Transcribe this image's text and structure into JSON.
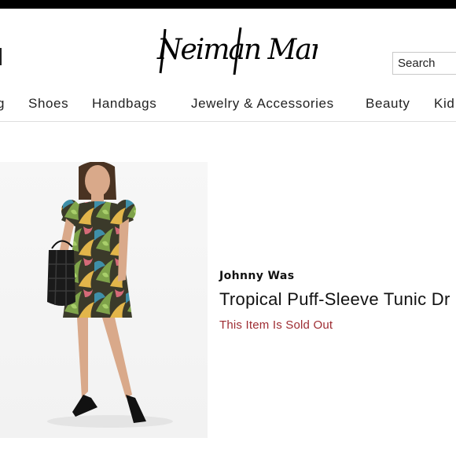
{
  "header": {
    "logo_text": "Neiman Marcus",
    "search": {
      "placeholder": "Search"
    }
  },
  "nav": {
    "items": [
      {
        "label": "g"
      },
      {
        "label": "Shoes"
      },
      {
        "label": "Handbags"
      },
      {
        "label": "Jewelry & Accessories"
      },
      {
        "label": "Beauty"
      },
      {
        "label": "Kid"
      }
    ]
  },
  "product": {
    "brand": "Johnny Was",
    "name": "Tropical Puff-Sleeve Tunic Dr",
    "status": "This Item Is Sold Out"
  },
  "colors": {
    "sold_out": "#9e2c32",
    "top_bar": "#000000",
    "nav_divider": "#dedede"
  }
}
